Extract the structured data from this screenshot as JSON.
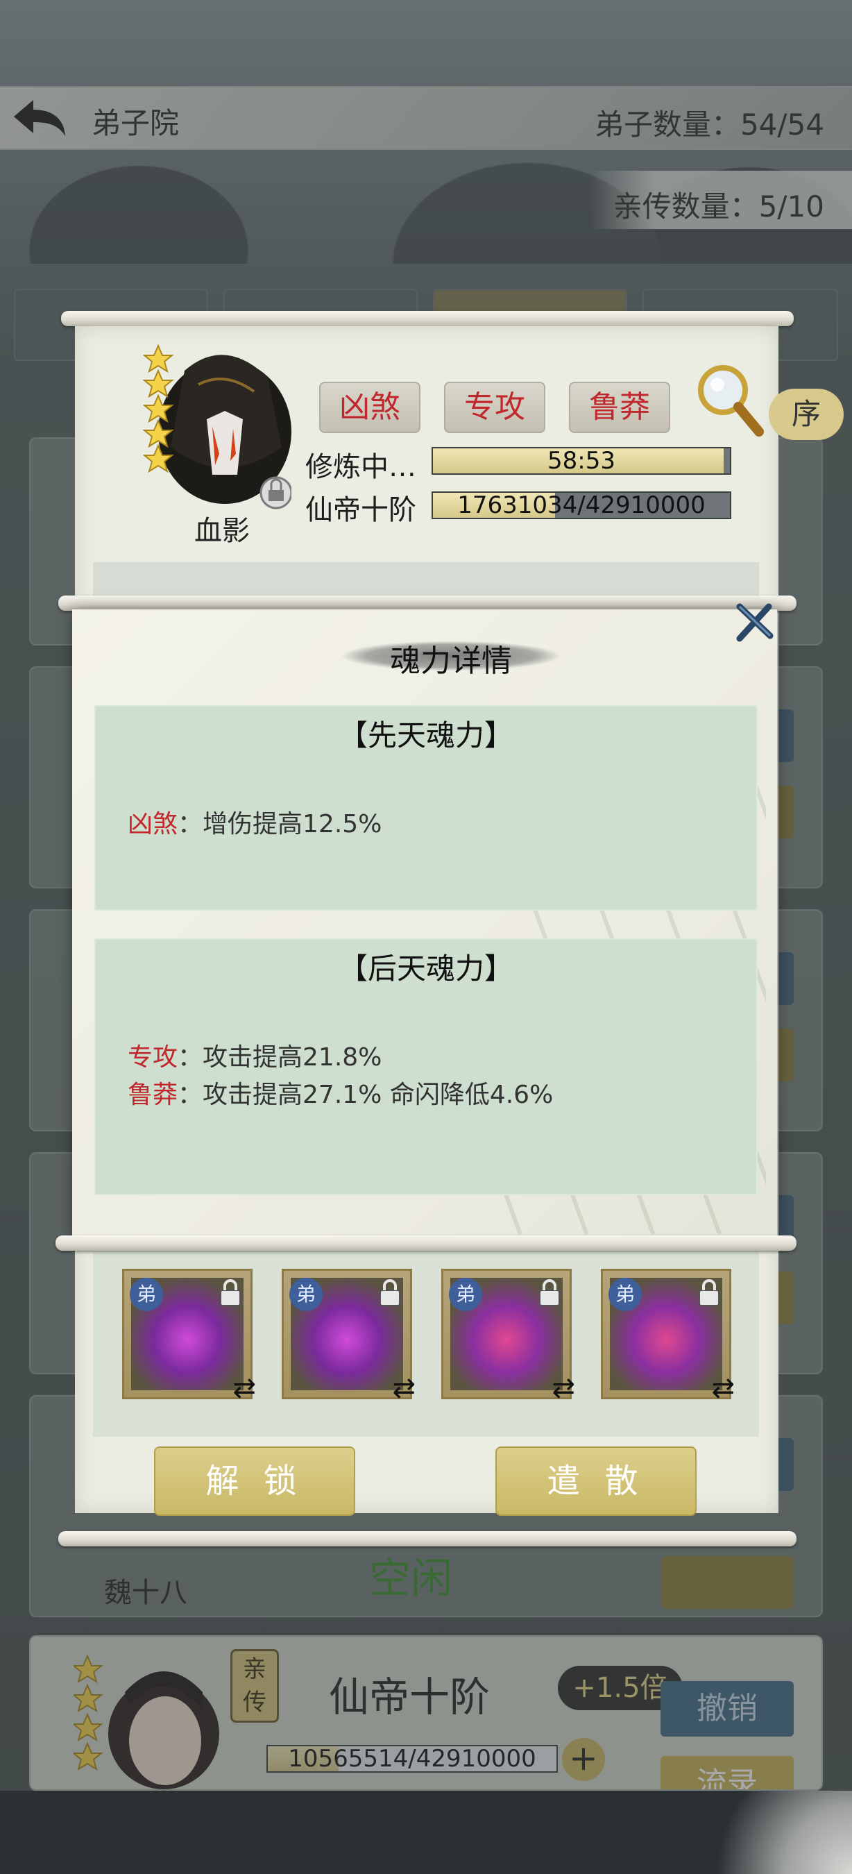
{
  "header": {
    "title": "弟子院",
    "disciple_count": "弟子数量：54/54",
    "direct_count": "亲传数量：5/10"
  },
  "sort_label": "序",
  "character": {
    "name": "血影",
    "traits": [
      "凶煞",
      "专攻",
      "鲁莽"
    ],
    "status_label": "修炼中…",
    "timer": "58:53",
    "rank": "仙帝十阶",
    "exp_text": "17631034/42910000",
    "exp_progress": 0.411,
    "actions": {
      "unlock": "解 锁",
      "dismiss": "遣 散"
    },
    "equip_badge": "弟",
    "swap_glyph": "⇄"
  },
  "dialog": {
    "title": "魂力详情",
    "innate": {
      "title": "【先天魂力】",
      "entries": [
        {
          "name": "凶煞",
          "effect": "：增伤提高12.5%"
        }
      ]
    },
    "acquired": {
      "title": "【后天魂力】",
      "entries": [
        {
          "name": "专攻",
          "effect": "：攻击提高21.8%"
        },
        {
          "name": "鲁莽",
          "effect": "：攻击提高27.1% 命闪降低4.6%"
        }
      ]
    }
  },
  "background_list": {
    "row_name": "魏十八",
    "row_status": "空闲",
    "bottom_card": {
      "badge": "亲传",
      "rank": "仙帝十阶",
      "multiplier": "+1.5倍",
      "exp_text": "10565514/42910000",
      "exp_progress": 0.246,
      "plus": "+",
      "revoke": "撤销",
      "record": "流录"
    }
  },
  "colors": {
    "trait_red": "#c0282e",
    "idle_green": "#3a8a2a",
    "gold_button": "#c9b865",
    "blue_button": "#416a85",
    "section_bg": "#cfdfcf"
  }
}
